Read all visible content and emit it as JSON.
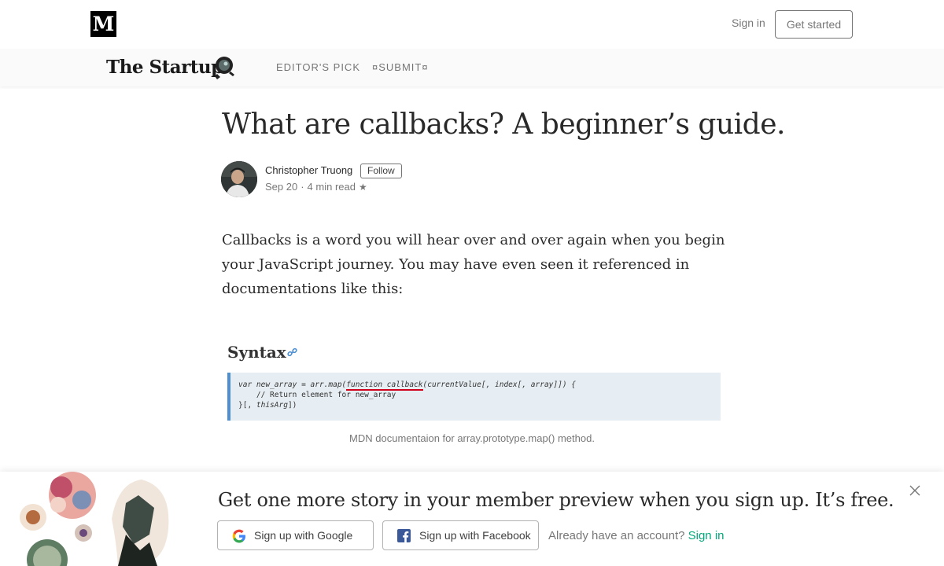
{
  "header": {
    "logo_letter": "M",
    "sign_in_label": "Sign in",
    "get_started_label": "Get started"
  },
  "publication": {
    "name": "The Startup",
    "nav": [
      "EDITOR'S PICK",
      "¤SUBMIT¤"
    ]
  },
  "article": {
    "title": "What are callbacks? A beginner’s guide.",
    "author": "Christopher Truong",
    "follow_label": "Follow",
    "date": "Sep 20",
    "read_time": "4 min read",
    "star_glyph": "★",
    "body": "Callbacks is a word you will hear over and over again when you begin your JavaScript journey. You may have even seen it referenced in documentations like this:"
  },
  "figure": {
    "heading": "Syntax",
    "code": {
      "line1_a": "var new_array = arr.map(",
      "line1_highlight": "function callback",
      "line1_b": "(currentValue[, index[, array]]) {",
      "line2": "    // Return element for new_array",
      "line3_a": "}[, ",
      "line3_b": "thisArg",
      "line3_c": "])"
    },
    "caption": "MDN documentaion for array.prototype.map() method."
  },
  "signup_overlay": {
    "heading": "Get one more story in your member preview when you sign up. It’s free.",
    "google_label": "Sign up with Google",
    "facebook_label": "Sign up with Facebook",
    "already_text": "Already have an account?",
    "sign_in_link": "Sign in"
  },
  "colors": {
    "accent_green": "#03a87c",
    "highlight_red": "#d0021b",
    "code_border_blue": "#4d8fd1",
    "facebook_blue": "#3b5998"
  }
}
